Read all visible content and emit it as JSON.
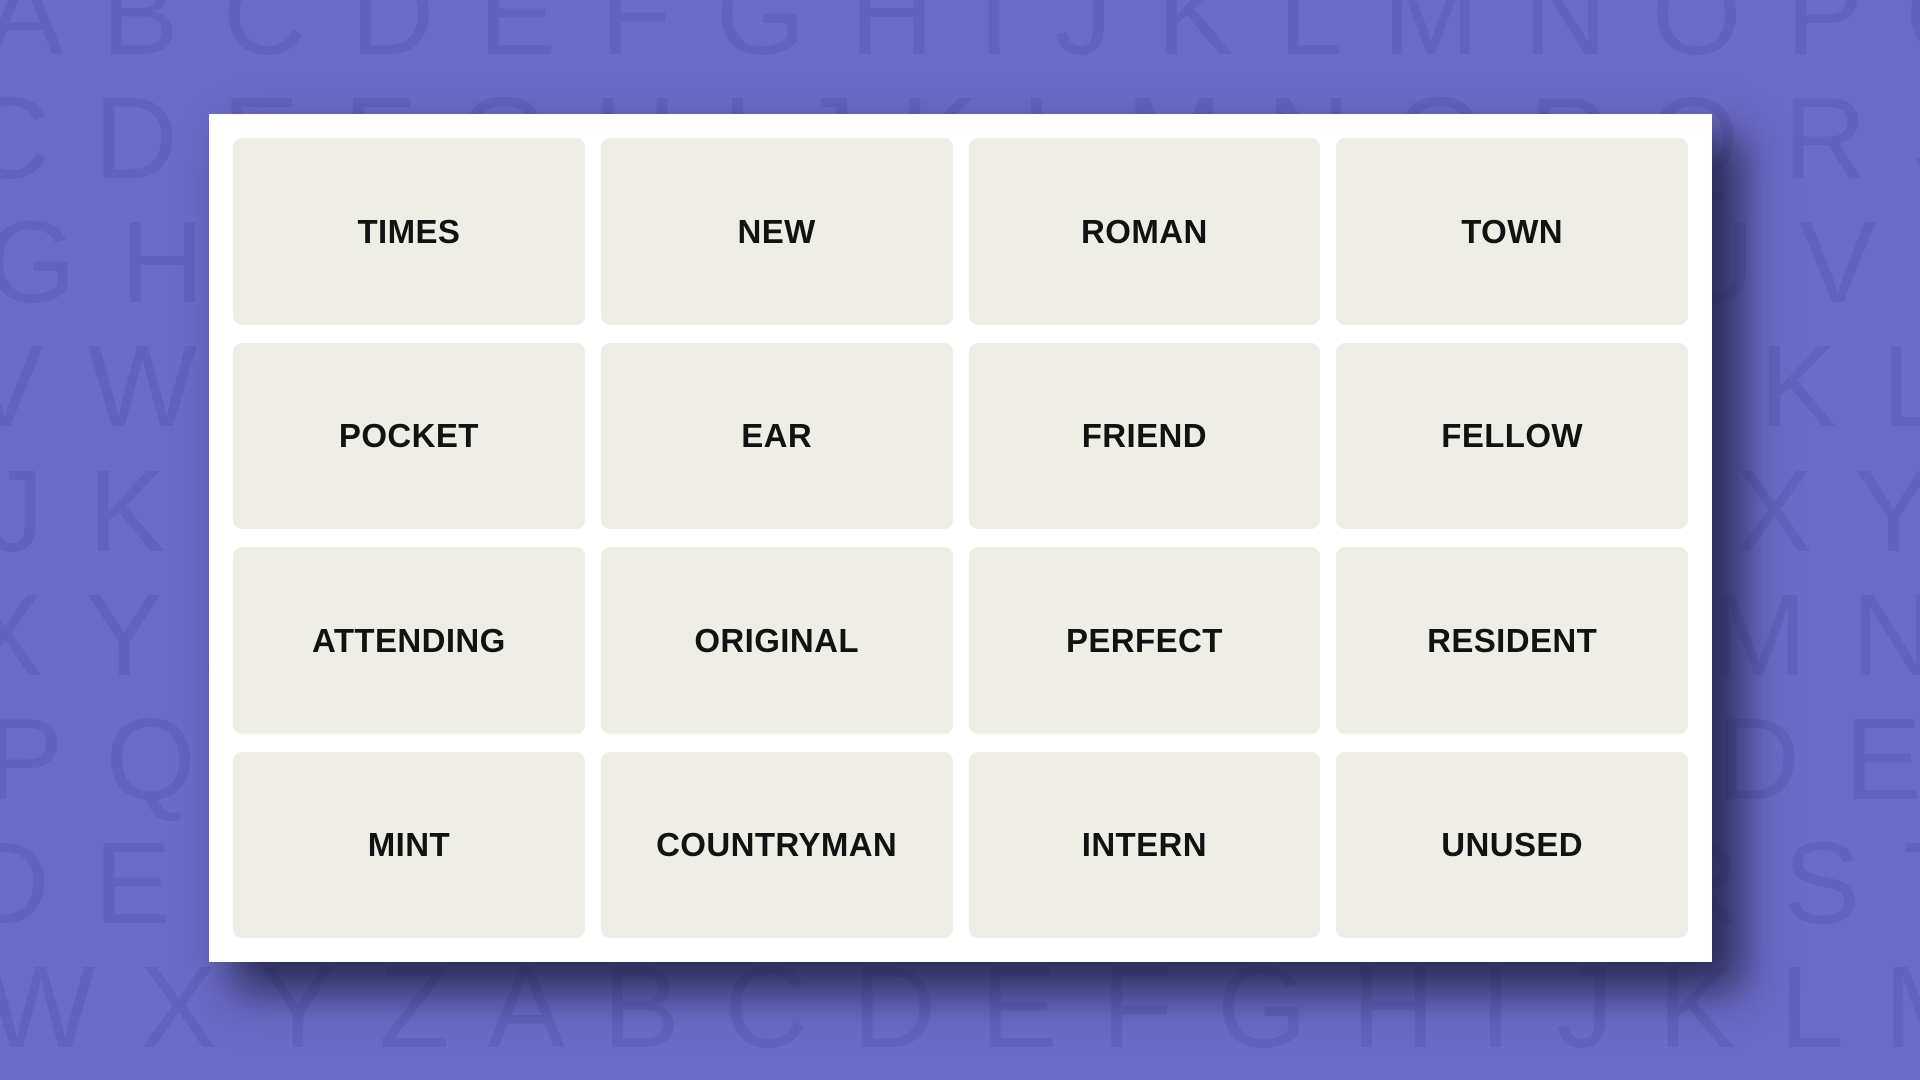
{
  "page": {
    "title": "Connections Puzzle Board",
    "background_color": "#6c6cc8",
    "background_letter_color": "#6262bd",
    "card_color": "#ffffff",
    "tile_color": "#efeee6",
    "tile_text_color": "#121212"
  },
  "background": {
    "pattern_name": "alphabet-wallpaper",
    "rows": [
      "ABCDEFGHIJKLMNOPQRSTUVWXYZABCDEF",
      "CDEFGHIJKLMNOPQRSTUVWXYZABCDEFGH",
      "GHIJKLMNOPQRSTUVWXYZABCDEFGHIJKL",
      "VWXYZABCDEFGHIJKLMNOPQRSTUVWXYZA",
      "JKLMNOPQRSTUVWXYZABCDEFGHIJKLMNO",
      "XYZABCDEFGHIJKLMNOPQRSTUVWXYZABC",
      "PQRSTUVWXYZABCDEFGHIJKLMNOPQRSTU",
      "DEFGHIJKLMNOPQRSTUVWXYZABCDEFGHI",
      "WXYZABCDEFGHIJKLMNOPQRSTUVWXYZAB"
    ]
  },
  "board": {
    "rows": 4,
    "columns": 4,
    "tiles": [
      {
        "label": "TIMES"
      },
      {
        "label": "NEW"
      },
      {
        "label": "ROMAN"
      },
      {
        "label": "TOWN"
      },
      {
        "label": "POCKET"
      },
      {
        "label": "EAR"
      },
      {
        "label": "FRIEND"
      },
      {
        "label": "FELLOW"
      },
      {
        "label": "ATTENDING"
      },
      {
        "label": "ORIGINAL"
      },
      {
        "label": "PERFECT"
      },
      {
        "label": "RESIDENT"
      },
      {
        "label": "MINT"
      },
      {
        "label": "COUNTRYMAN"
      },
      {
        "label": "INTERN"
      },
      {
        "label": "UNUSED"
      }
    ]
  }
}
